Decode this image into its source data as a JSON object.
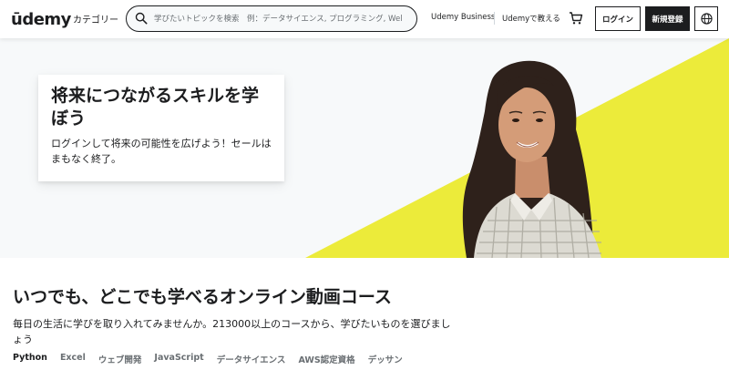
{
  "header": {
    "logo_text": "ūdemy",
    "categories_label": "カテゴリー",
    "search_placeholder": "学びたいトピックを検索　例：データサイエンス, プログラミング, Wel",
    "udemy_business": "Udemy Business",
    "teach_on_udemy": "Udemyで教える",
    "login_label": "ログイン",
    "signup_label": "新規登録"
  },
  "hero": {
    "headline": "将来につながるスキルを学ぼう",
    "subtext": "ログインして将来の可能性を広げよう！セールはまもなく終了。",
    "accent_color": "#eceb3a"
  },
  "section": {
    "title": "いつでも、どこでも学べるオンライン動画コース",
    "description": "毎日の生活に学びを取り入れてみませんか。213000以上のコースから、学びたいものを選びましょう",
    "tabs": [
      "Python",
      "Excel",
      "ウェブ開発",
      "JavaScript",
      "データサイエンス",
      "AWS認定資格",
      "デッサン"
    ]
  }
}
